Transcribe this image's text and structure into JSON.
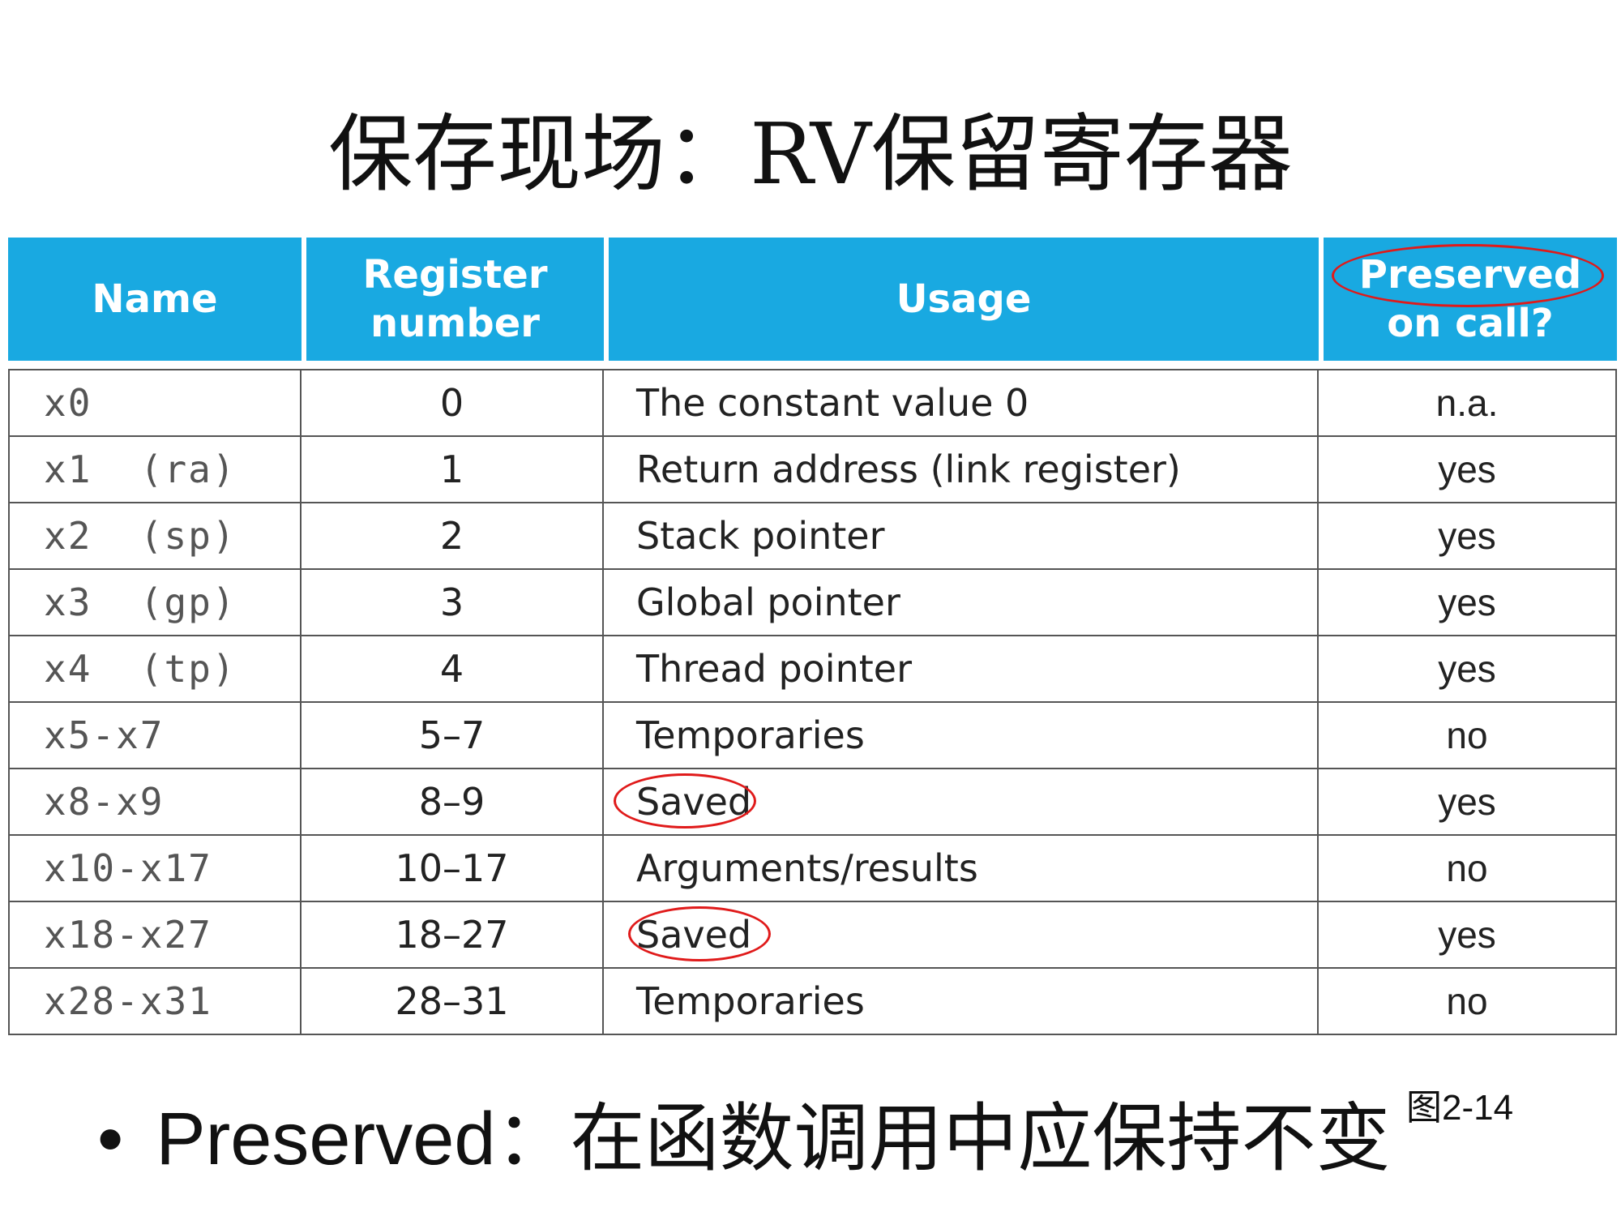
{
  "title": {
    "text": "保存现场：RV保留寄存器"
  },
  "table": {
    "headers": {
      "name": [
        "Name"
      ],
      "register_number": [
        "Register",
        "number"
      ],
      "usage": [
        "Usage"
      ],
      "preserved": [
        "Preserved",
        "on call?"
      ]
    },
    "rows": [
      {
        "name": "x0",
        "number": "0",
        "usage": "The constant value 0",
        "preserved": "n.a."
      },
      {
        "name": "x1  (ra)",
        "number": "1",
        "usage": "Return address (link register)",
        "preserved": "yes"
      },
      {
        "name": "x2  (sp)",
        "number": "2",
        "usage": "Stack pointer",
        "preserved": "yes"
      },
      {
        "name": "x3  (gp)",
        "number": "3",
        "usage": "Global pointer",
        "preserved": "yes"
      },
      {
        "name": "x4  (tp)",
        "number": "4",
        "usage": "Thread pointer",
        "preserved": "yes"
      },
      {
        "name": "x5-x7",
        "number": "5–7",
        "usage": "Temporaries",
        "preserved": "no"
      },
      {
        "name": "x8-x9",
        "number": "8–9",
        "usage": "Saved",
        "preserved": "yes"
      },
      {
        "name": "x10-x17",
        "number": "10–17",
        "usage": "Arguments/results",
        "preserved": "no"
      },
      {
        "name": "x18-x27",
        "number": "18–27",
        "usage": "Saved",
        "preserved": "yes"
      },
      {
        "name": "x28-x31",
        "number": "28–31",
        "usage": "Temporaries",
        "preserved": "no"
      }
    ]
  },
  "caption": "图2-14",
  "bullet": {
    "marker": "•",
    "term": "Preserved：",
    "text": "在函数调用中应保持不变"
  },
  "colors": {
    "header_bg": "#19a9e1",
    "annotation": "#e01a1a"
  }
}
